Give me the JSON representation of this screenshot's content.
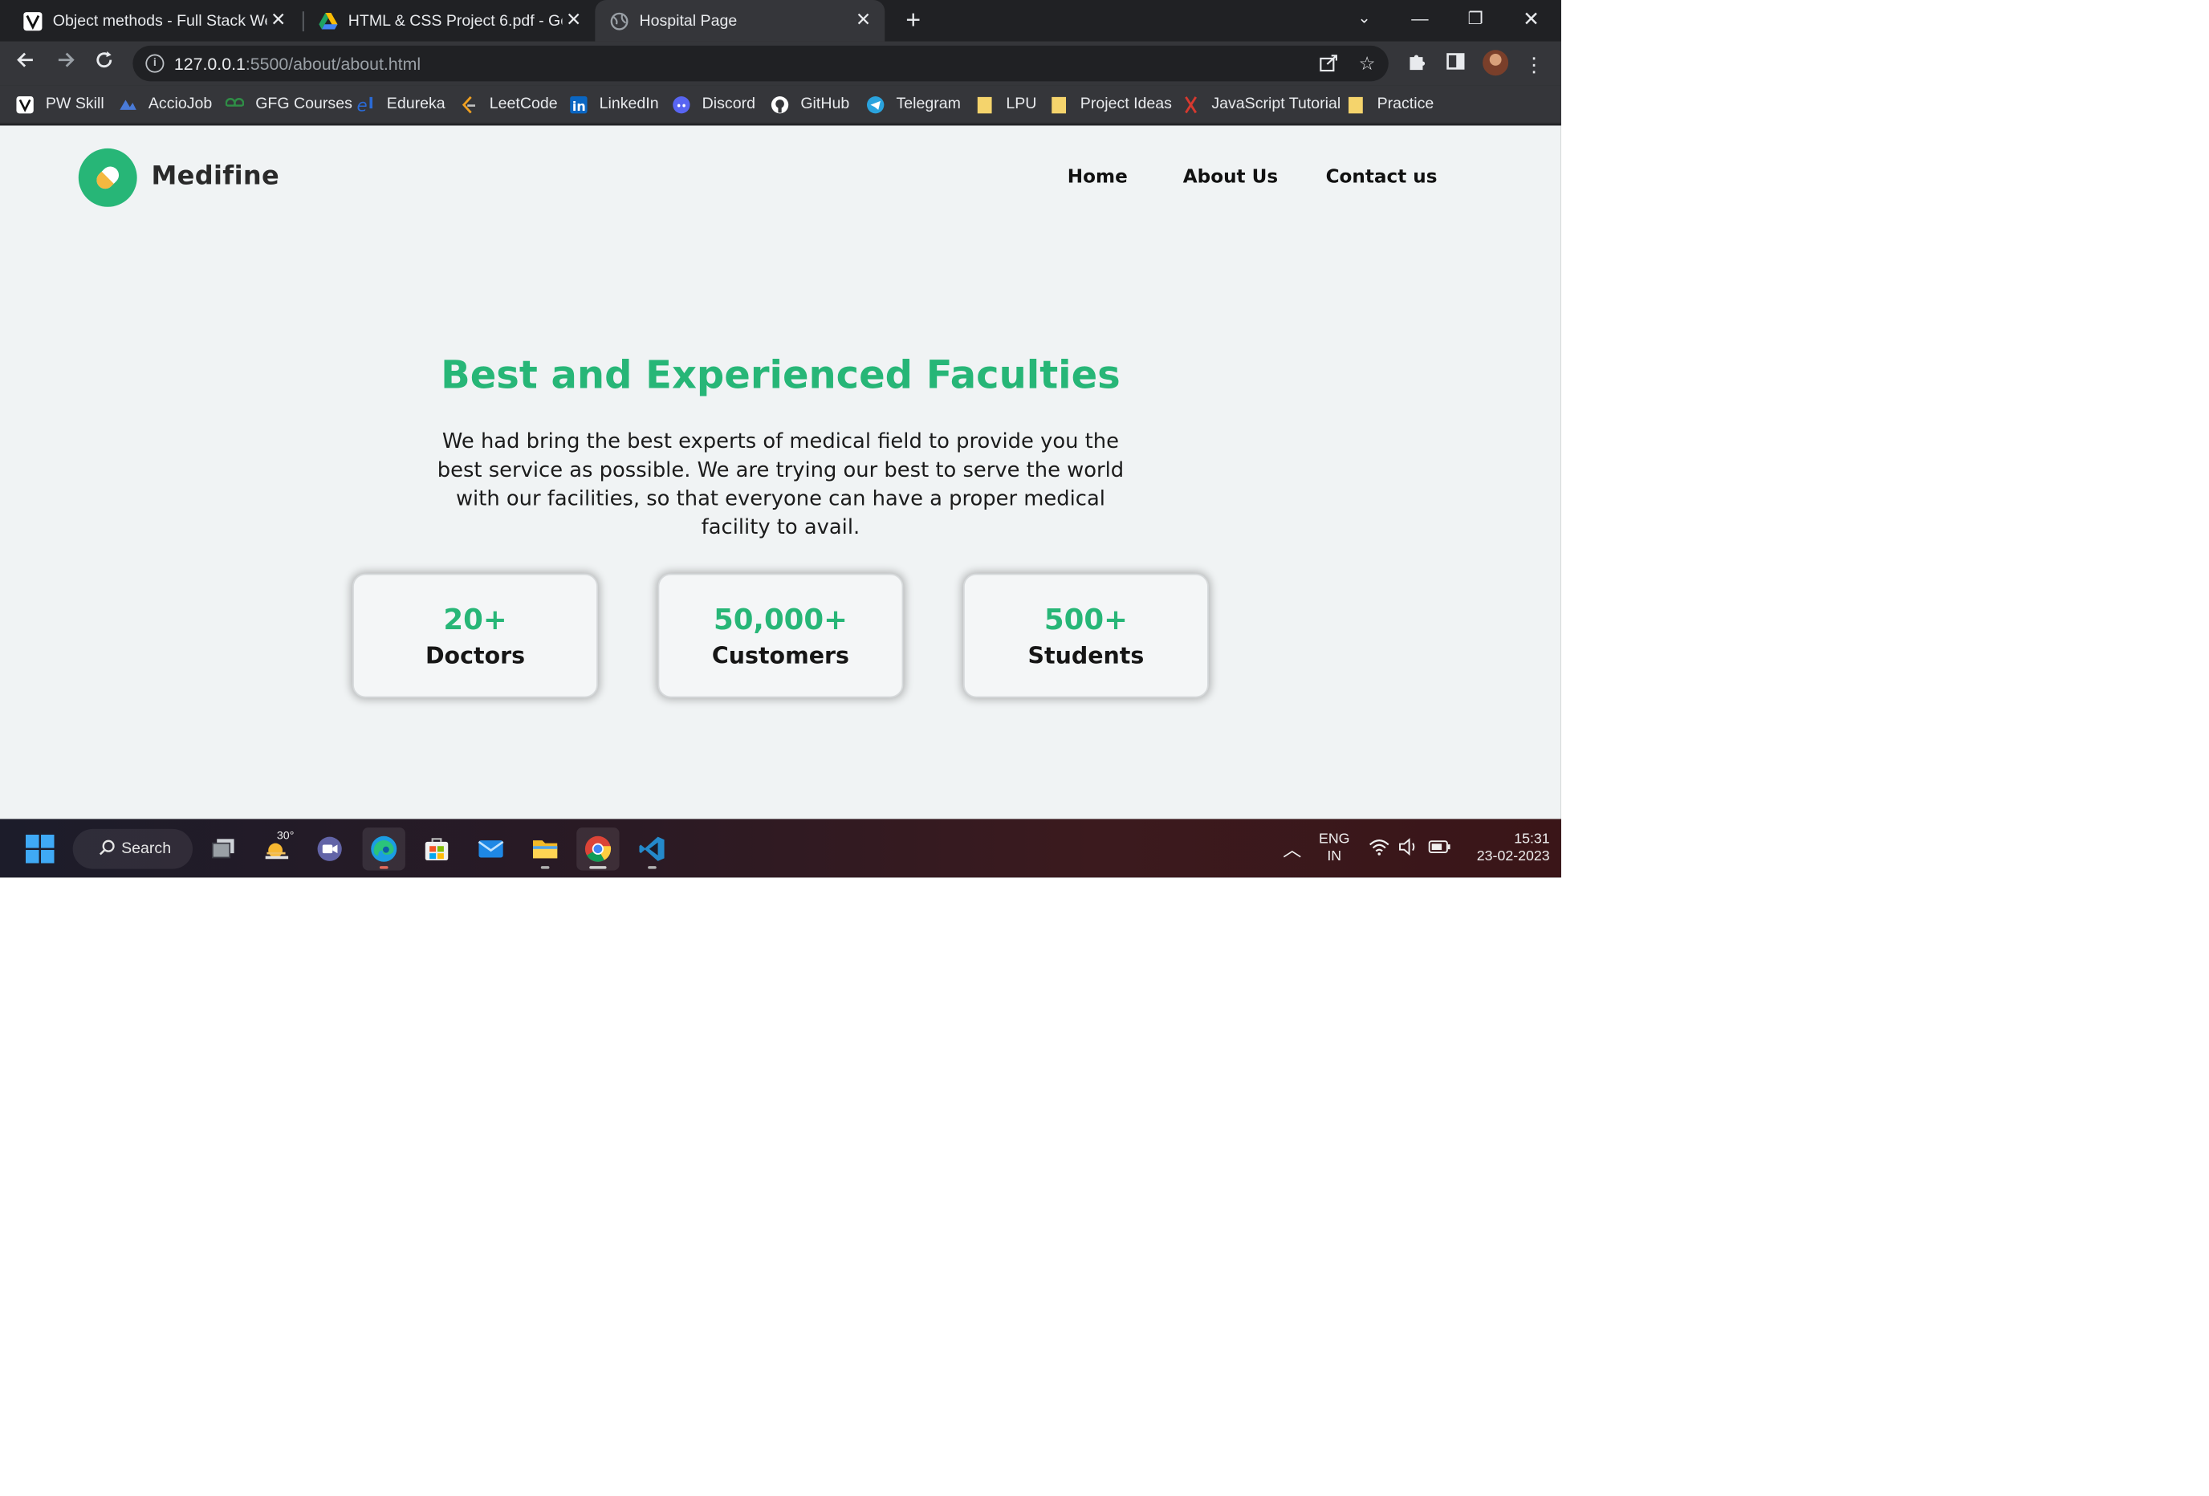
{
  "browser": {
    "tabs": [
      {
        "title": "Object methods - Full Stack Web",
        "active": false
      },
      {
        "title": "HTML & CSS Project 6.pdf - Goo",
        "active": false
      },
      {
        "title": "Hospital Page",
        "active": true
      }
    ],
    "new_tab_label": "+",
    "url_host": "127.0.0.1",
    "url_path": ":5500/about/about.html",
    "bookmarks": [
      {
        "label": "PW Skill"
      },
      {
        "label": "AccioJob"
      },
      {
        "label": "GFG Courses"
      },
      {
        "label": "Edureka"
      },
      {
        "label": "LeetCode"
      },
      {
        "label": "LinkedIn"
      },
      {
        "label": "Discord"
      },
      {
        "label": "GitHub"
      },
      {
        "label": "Telegram"
      },
      {
        "label": "LPU"
      },
      {
        "label": "Project Ideas"
      },
      {
        "label": "JavaScript Tutorial"
      },
      {
        "label": "Practice"
      }
    ]
  },
  "page": {
    "brand": "Medifine",
    "nav": [
      "Home",
      "About Us",
      "Contact us"
    ],
    "hero_title": "Best and Experienced Faculties",
    "hero_description": "We had bring the best experts of medical field to provide you the best service as possible. We are trying our best to serve the world with our facilities, so that everyone can have a proper medical facility to avail.",
    "stats": [
      {
        "value": "20+",
        "label": "Doctors"
      },
      {
        "value": "50,000+",
        "label": "Customers"
      },
      {
        "value": "500+",
        "label": "Students"
      }
    ],
    "accent_color": "#27b677"
  },
  "taskbar": {
    "search_label": "Search",
    "weather_temp": "30°",
    "language": "ENG",
    "region": "IN",
    "time": "15:31",
    "date": "23-02-2023"
  }
}
